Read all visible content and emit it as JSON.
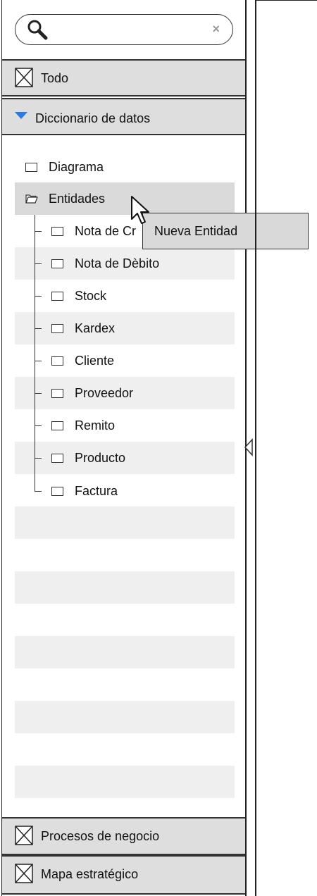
{
  "search": {
    "placeholder": "",
    "clear_icon": "×"
  },
  "sections": {
    "todo": "Todo",
    "diccionario": "Diccionario de datos",
    "procesos": "Procesos de negocio",
    "mapa": "Mapa estratégico"
  },
  "tree": {
    "diagrama": "Diagrama",
    "entidades": "Entidades",
    "children": [
      "Nota de Cr",
      "Nota de Dèbito",
      "Stock",
      "Kardex",
      "Cliente",
      "Proveedor",
      "Remito",
      "Producto",
      "Factura"
    ]
  },
  "context_menu": {
    "item": "Nueva Entidad"
  },
  "colors": {
    "accent": "#2d7be0",
    "header_bg": "#dedede",
    "band": "#efefef",
    "selected": "#dadada"
  }
}
